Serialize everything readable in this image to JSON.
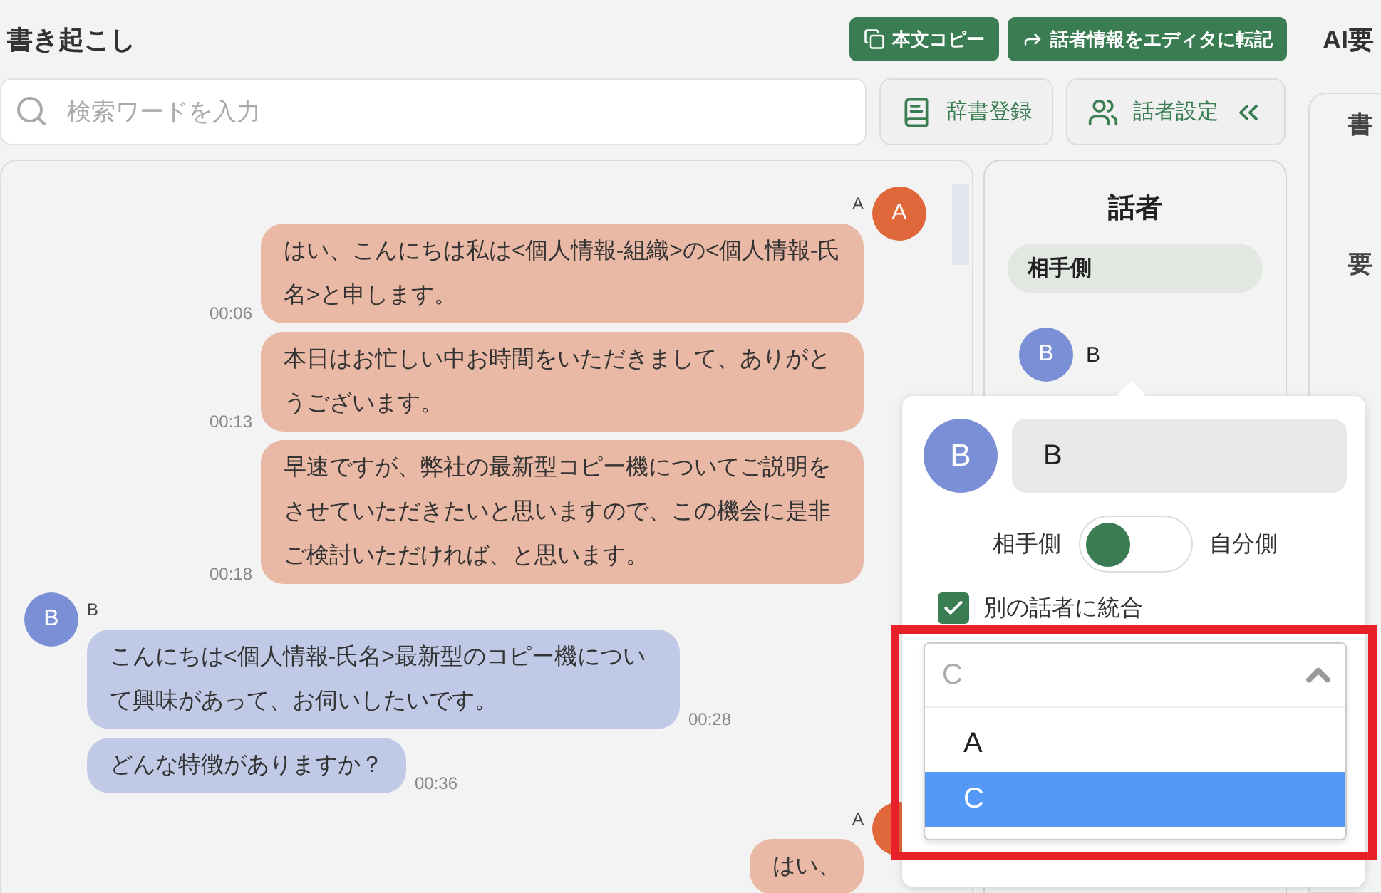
{
  "header": {
    "title": "書き起こし",
    "actions": [
      {
        "label": "本文コピー",
        "kind": "copy"
      },
      {
        "label": "話者情報をエディタに転記",
        "kind": "forward"
      }
    ]
  },
  "search": {
    "placeholder": "検索ワードを入力"
  },
  "tools": [
    {
      "label": "辞書登録",
      "kind": "book",
      "chevrons": false
    },
    {
      "label": "話者設定",
      "kind": "people",
      "chevrons": true
    }
  ],
  "groups": [
    {
      "speaker": "A",
      "avatar": "A",
      "kind": "self",
      "color": "#e0673a",
      "messages": [
        {
          "text": "はい、こんにちは私は<個人情報-組織>の<個人情報-氏名>と申します。",
          "time": "00:06"
        },
        {
          "text": "本日はお忙しい中お時間をいただきまして、ありがとうございます。",
          "time": "00:13"
        },
        {
          "text": "早速ですが、弊社の最新型コピー機についてご説明をさせていただきたいと思いますので、この機会に是非ご検討いただければ、と思います。",
          "time": "00:18"
        }
      ]
    },
    {
      "speaker": "B",
      "avatar": "B",
      "kind": "other",
      "color": "#7b8fd6",
      "messages": [
        {
          "text": "こんにちは<個人情報-氏名>最新型のコピー機について興味があって、お伺いしたいです。",
          "time": "00:28"
        },
        {
          "text": "どんな特徴がありますか？",
          "time": "00:36"
        }
      ]
    },
    {
      "speaker": "A",
      "kind": "self",
      "color": "#e0673a",
      "messages": [
        {
          "text": "はい、"
        }
      ]
    }
  ],
  "speaker_panel": {
    "title": "話者",
    "group": "相手側",
    "speakers": [
      {
        "avatar": "B",
        "name": "B",
        "color": "#7b8fd6"
      }
    ]
  },
  "summary_panel": {
    "title": "AI要",
    "items": [
      "書",
      "要"
    ]
  },
  "popover": {
    "avatar": "B",
    "color": "#7b8fd6",
    "name": "B",
    "toggle": {
      "left": "相手側",
      "right": "自分側",
      "on": false
    },
    "merge": {
      "label": "別の話者に統合",
      "checked": true
    },
    "select": {
      "value": "C",
      "expanded": true,
      "options": [
        {
          "label": "A",
          "selected": false
        },
        {
          "label": "C",
          "selected": true
        }
      ]
    }
  }
}
